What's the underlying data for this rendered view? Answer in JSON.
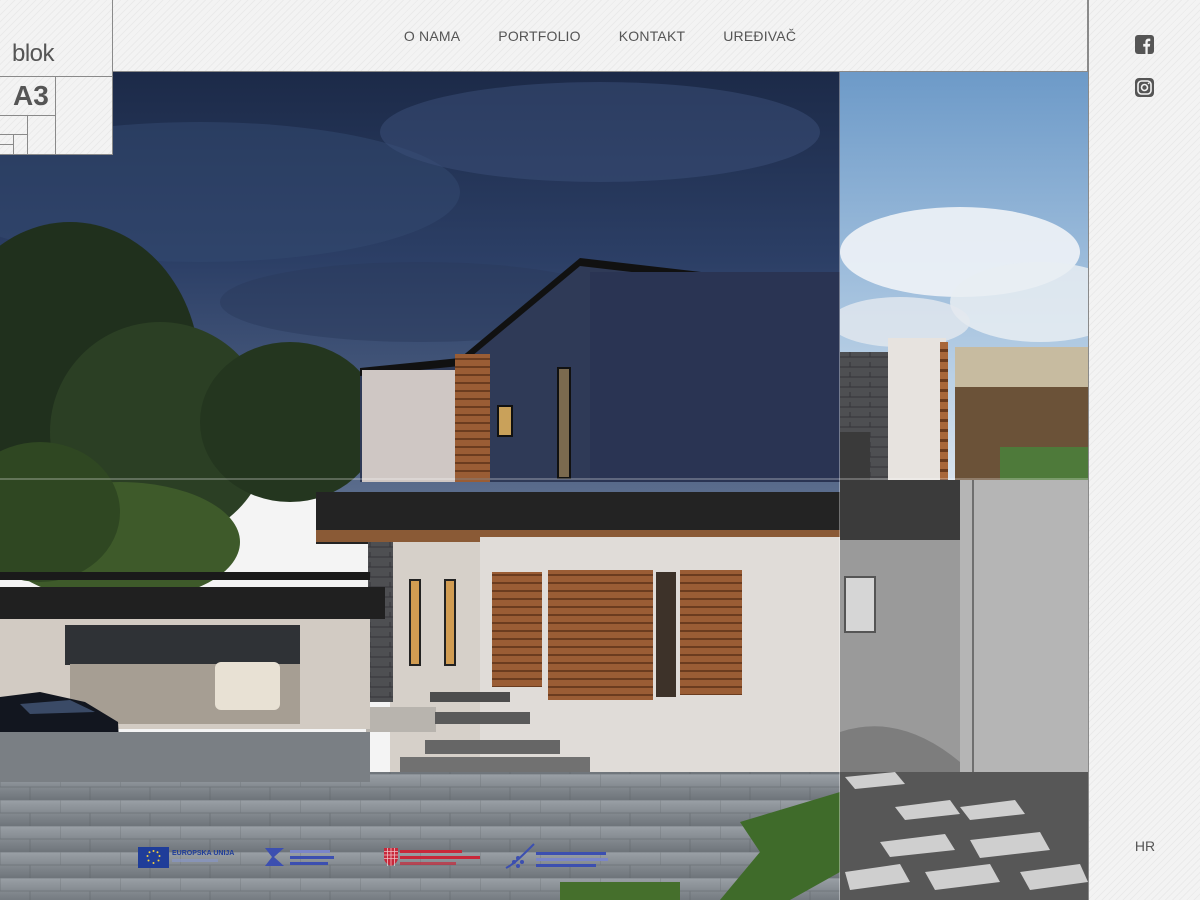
{
  "logo": {
    "word": "blok",
    "mark": "A3"
  },
  "nav": {
    "items": [
      {
        "label": "O NAMA"
      },
      {
        "label": "PORTFOLIO"
      },
      {
        "label": "KONTAKT"
      },
      {
        "label": "UREĐIVAČ"
      }
    ]
  },
  "sidebar": {
    "social": [
      {
        "icon": "facebook-icon"
      },
      {
        "icon": "instagram-icon"
      }
    ],
    "language": "HR"
  },
  "funding": {
    "eu_label": "EUROPSKA UNIJA"
  },
  "colors": {
    "text": "#555555",
    "border": "#8a8a8a",
    "sky_night": "#23324f",
    "sky_day": "#8fb3d8",
    "wood": "#a0643a"
  }
}
